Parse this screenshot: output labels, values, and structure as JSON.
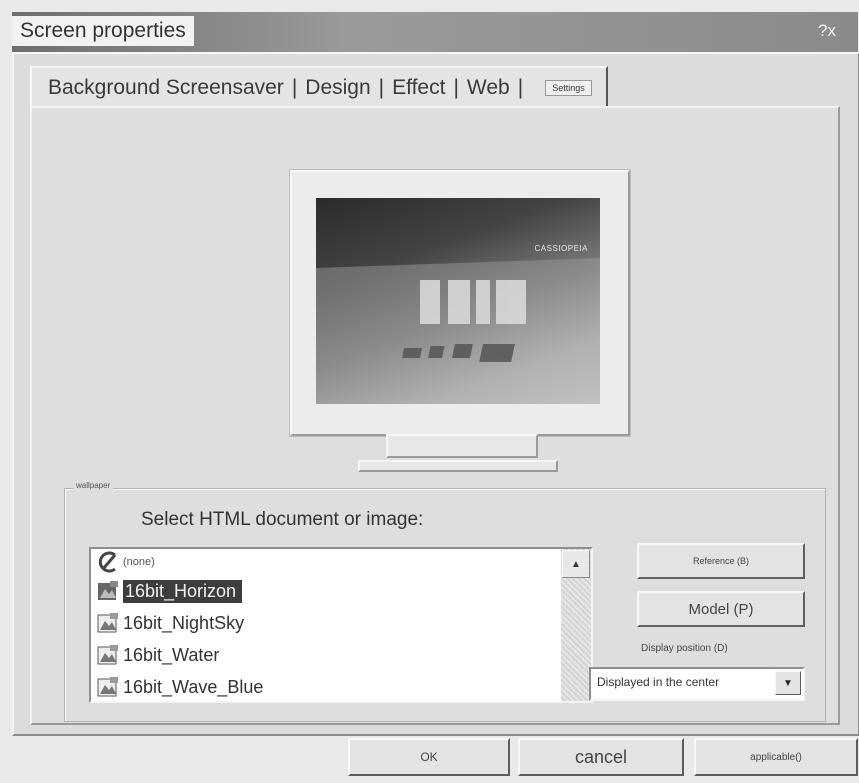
{
  "window": {
    "title": "Screen properties",
    "help_close": "?x"
  },
  "tabs": {
    "background_screensaver": "Background Screensaver",
    "design": "Design",
    "effect": "Effect",
    "web": "Web",
    "separator": "|",
    "settings": "Settings"
  },
  "preview": {
    "screen_text": "CASSIOPEIA"
  },
  "wallpaper": {
    "group_label": "wallpaper",
    "prompt": "Select HTML document or image:",
    "items": [
      {
        "label": "(none)",
        "icon": "none-icon"
      },
      {
        "label": "16bit_Horizon",
        "icon": "image-file-icon"
      },
      {
        "label": "16bit_NightSky",
        "icon": "image-file-icon"
      },
      {
        "label": "16bit_Water",
        "icon": "image-file-icon"
      },
      {
        "label": "16bit_Wave_Blue",
        "icon": "image-file-icon"
      }
    ],
    "selected_item": "16bit_Horizon",
    "reference_button": "Reference (B)",
    "model_button": "Model (P)",
    "display_position_label": "Display position (D)",
    "display_position_value": "Displayed in the center"
  },
  "footer": {
    "ok": "OK",
    "cancel": "cancel",
    "apply": "applicable()"
  },
  "colors": {
    "selection": "#3d3d3d",
    "dialog_bg": "#dcdcda",
    "titlebar": "#8a8a88"
  }
}
